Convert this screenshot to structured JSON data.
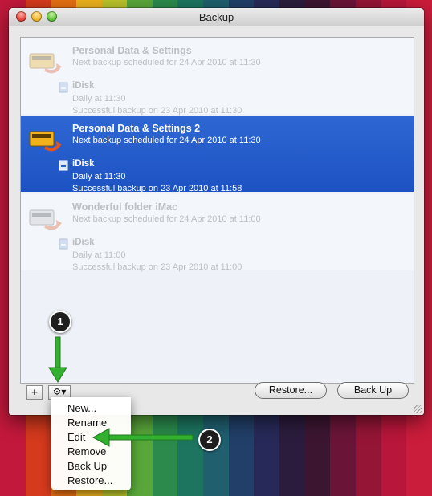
{
  "window": {
    "title": "Backup"
  },
  "entries": [
    {
      "name": "Personal Data & Settings",
      "next": "Next backup scheduled for 24 Apr 2010 at 11:30",
      "dest": {
        "name": "iDisk",
        "schedule": "Daily at 11:30",
        "last": "Successful backup on 23 Apr 2010 at 11:30"
      }
    },
    {
      "name": "Personal Data & Settings 2",
      "next": "Next backup scheduled for 24 Apr 2010 at 11:30",
      "dest": {
        "name": "iDisk",
        "schedule": "Daily at 11:30",
        "last": "Successful backup on 23 Apr 2010 at 11:58"
      }
    },
    {
      "name": "Wonderful folder iMac",
      "next": "Next backup scheduled for 24 Apr 2010 at 11:00",
      "dest": {
        "name": "iDisk",
        "schedule": "Daily at 11:00",
        "last": "Successful backup on 23 Apr 2010 at 11:00"
      }
    }
  ],
  "toolbar": {
    "add_label": "+",
    "gear_label": "⚙▾",
    "restore_label": "Restore...",
    "backup_label": "Back Up"
  },
  "menu": {
    "items": [
      "New...",
      "Rename",
      "Edit",
      "Remove",
      "Back Up",
      "Restore..."
    ]
  },
  "callouts": [
    "1",
    "2"
  ],
  "colors": {
    "selection": "#2462d0",
    "arrow": "#33b030",
    "callout": "#1e1e1e"
  },
  "icons": {
    "backup": "backup-drive-icon",
    "disk": "idisk-icon",
    "gear": "gear-icon",
    "add": "plus-icon",
    "arrow": "green-arrow-icon"
  }
}
